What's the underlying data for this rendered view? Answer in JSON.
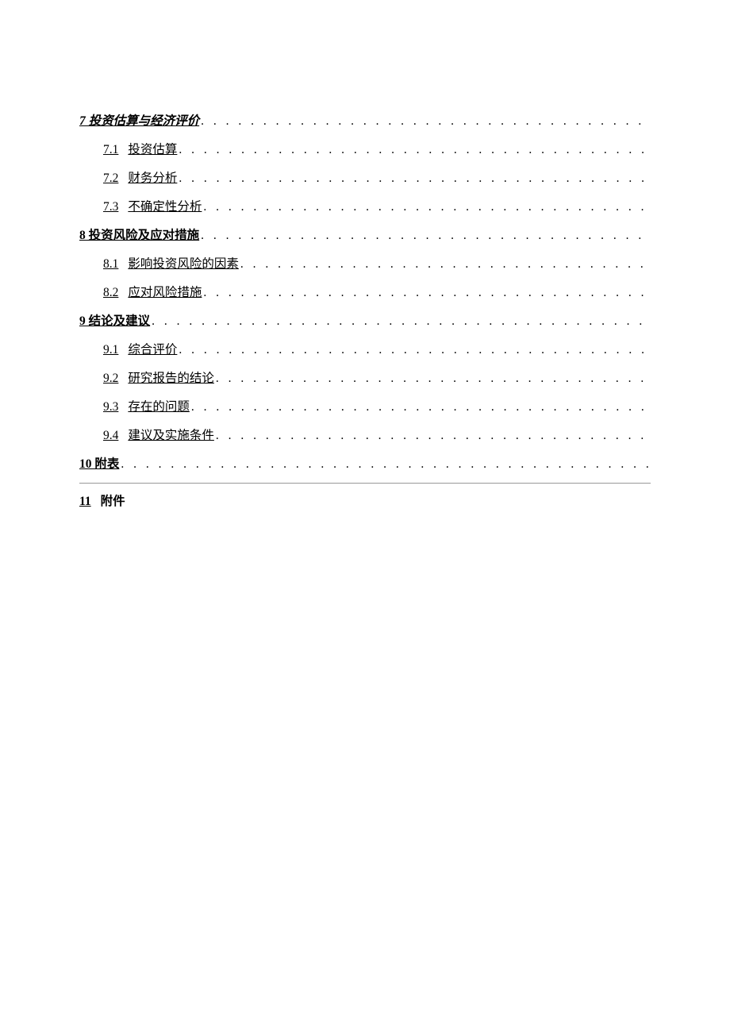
{
  "toc": [
    {
      "level": 1,
      "number": "7",
      "title": "投资估算与经济评价",
      "italic": true
    },
    {
      "level": 2,
      "number": "7.1",
      "title": "投资估算"
    },
    {
      "level": 2,
      "number": "7.2",
      "title": "财务分析"
    },
    {
      "level": 2,
      "number": "7.3",
      "title": "不确定性分析"
    },
    {
      "level": 1,
      "number": "8",
      "title": "投资风险及应对措施"
    },
    {
      "level": 2,
      "number": "8.1",
      "title": "影响投资风险的因素"
    },
    {
      "level": 2,
      "number": "8.2",
      "title": "应对风险措施"
    },
    {
      "level": 1,
      "number": "9",
      "title": "结论及建议"
    },
    {
      "level": 2,
      "number": "9.1",
      "title": "综合评价"
    },
    {
      "level": 2,
      "number": "9.2",
      "title": "研究报告的结论"
    },
    {
      "level": 2,
      "number": "9.3",
      "title": "存在的问题"
    },
    {
      "level": 2,
      "number": "9.4",
      "title": "建议及实施条件"
    },
    {
      "level": 1,
      "number": "10",
      "title": "附表"
    }
  ],
  "final": {
    "number": "11",
    "title": "附件"
  },
  "leader": ". . . . . . . . . . . . . . . . . . . . . . . . . . . . . . . . . . . . . . . . . . . . . . . . . . . . . . . . . . . . . . . . . . . . . . . . . . . . . . . . . . . . . . . . . ."
}
